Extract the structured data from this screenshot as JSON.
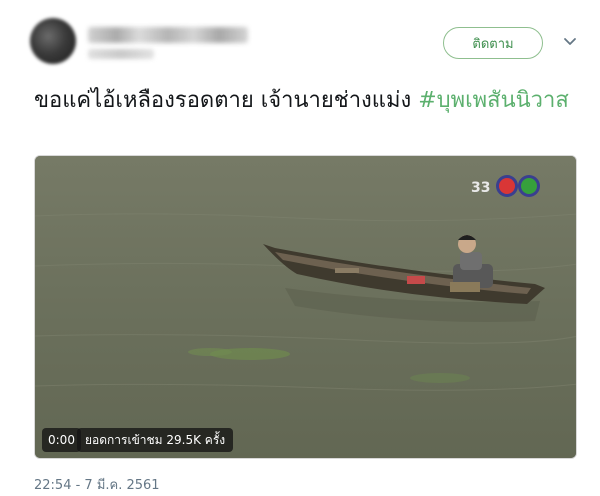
{
  "header": {
    "follow_label": "ติดตาม",
    "avatar_icon": "avatar-blurred",
    "menu_icon": "chevron-down-icon"
  },
  "tweet": {
    "text_main": "ขอแค่ไอ้เหลืองรอดตาย เจ้านายช่างแม่ง ",
    "hashtag": "#บุพเพสันนิวาส"
  },
  "video": {
    "duration": "0:00",
    "views_label": "ยอดการเข้าชม 29.5K ครั้ง",
    "channel_icon": "channel-33-logo"
  },
  "footer": {
    "timestamp": "22:54 - 7 มี.ค. 2561"
  },
  "colors": {
    "accent_green": "#5cb06e",
    "follow_border": "#8fbf8f",
    "water": "#6f735f"
  }
}
